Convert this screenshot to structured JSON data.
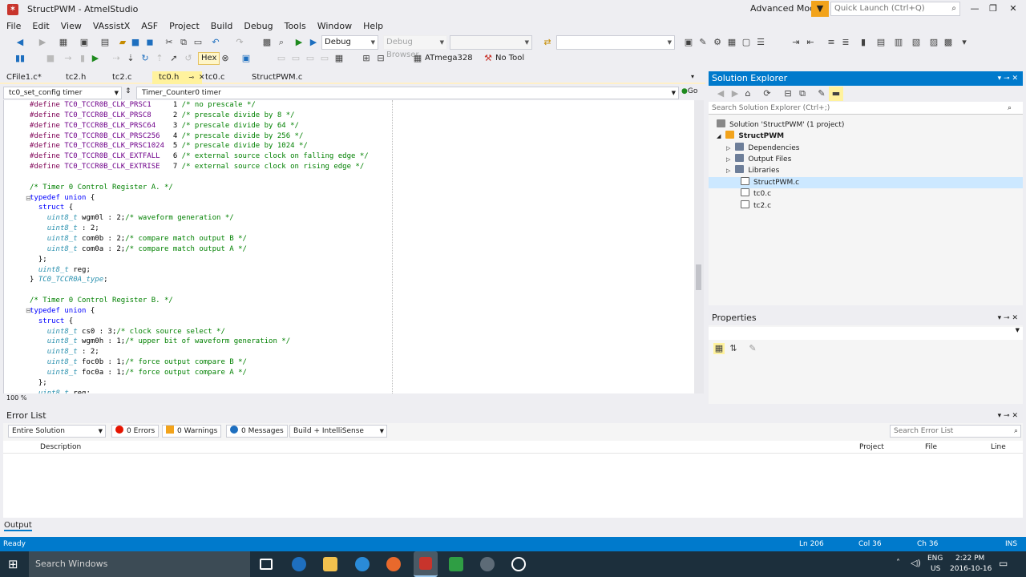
{
  "window": {
    "title": "StructPWM - AtmelStudio",
    "mode": "Advanced Mode",
    "quick_launch": "Quick Launch (Ctrl+Q)"
  },
  "menu": [
    "File",
    "Edit",
    "View",
    "VAssistX",
    "ASF",
    "Project",
    "Build",
    "Debug",
    "Tools",
    "Window",
    "Help"
  ],
  "toolbar1": {
    "config": "Debug",
    "debug_browser": "Debug Browser"
  },
  "toolbar2": {
    "hex": "Hex",
    "device": "ATmega328",
    "tool": "No Tool"
  },
  "tabs": [
    "CFile1.c*",
    "tc2.h",
    "tc2.c",
    "tc0.h",
    "tc0.c",
    "StructPWM.c"
  ],
  "navbar": {
    "scope": "tc0_set_config timer",
    "member": "Timer_Counter0 timer",
    "go": "Go"
  },
  "editor": {
    "zoom": "100 %"
  },
  "solution": {
    "title": "Solution Explorer",
    "search": "Search Solution Explorer (Ctrl+;)",
    "items": [
      "Solution 'StructPWM' (1 project)",
      "StructPWM",
      "Dependencies",
      "Output Files",
      "Libraries",
      "StructPWM.c",
      "tc0.c",
      "tc2.c"
    ]
  },
  "properties": {
    "title": "Properties"
  },
  "errors": {
    "title": "Error List",
    "scope": "Entire Solution",
    "errors": "0 Errors",
    "warnings": "0 Warnings",
    "messages": "0 Messages",
    "build": "Build + IntelliSense",
    "search": "Search Error List",
    "columns": [
      "Description",
      "Project",
      "File",
      "Line"
    ]
  },
  "output": {
    "label": "Output"
  },
  "status": {
    "state": "Ready",
    "ln": "Ln 206",
    "col": "Col 36",
    "ch": "Ch 36",
    "ins": "INS"
  },
  "taskbar": {
    "search": "Search Windows",
    "lang": "ENG",
    "region": "US",
    "time": "2:22 PM",
    "date": "2016-10-16"
  }
}
